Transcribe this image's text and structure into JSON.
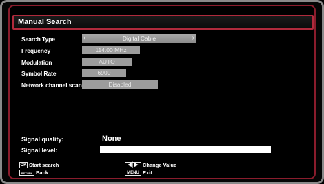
{
  "dialog": {
    "title": "Manual Search"
  },
  "settings": {
    "search_type": {
      "label": "Search Type",
      "value": "Digital Cable"
    },
    "frequency": {
      "label": "Frequency",
      "value": "114.00 MHz"
    },
    "modulation": {
      "label": "Modulation",
      "value": "AUTO"
    },
    "symbol_rate": {
      "label": "Symbol Rate",
      "value": "6900"
    },
    "network_scan": {
      "label": "Network channel scan",
      "value": "Disabled"
    }
  },
  "signal": {
    "quality_label": "Signal quality:",
    "quality_value": "None",
    "level_label": "Signal level:",
    "level_fraction": 1.0
  },
  "help": {
    "ok_key": "OK",
    "start_search": "Start search",
    "return_key": "RETURN",
    "back": "Back",
    "change_value": "Change Value",
    "menu_key": "MENU",
    "exit": "Exit"
  },
  "colors": {
    "accent": "#b02a3c",
    "field": "#9c9c9c"
  },
  "icons": {
    "left_right": "left-right-arrows-icon"
  }
}
